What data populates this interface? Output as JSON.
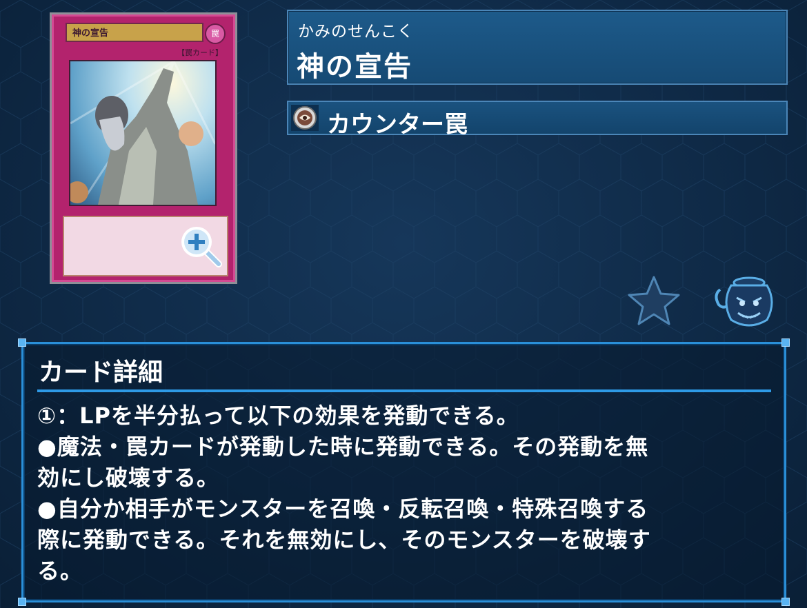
{
  "card": {
    "image_name": "神の宣告",
    "image_attribute": "罠",
    "image_type": "【罠カード】"
  },
  "header": {
    "ruby": "かみのせんこく",
    "title": "神の宣告"
  },
  "type": {
    "icon": "counter-trap-icon",
    "label": "カウンター罠"
  },
  "actions": {
    "favorite_icon": "star-icon",
    "pot_icon": "pot-of-greed-icon",
    "zoom_icon": "magnify-plus-icon"
  },
  "detail": {
    "heading": "カード詳細",
    "lines": [
      "①：LPを半分払って以下の効果を発動できる。",
      "●魔法・罠カードが発動した時に発動できる。その発動を無",
      "効にし破壊する。",
      "●自分か相手がモンスターを召喚・反転召喚・特殊召喚する",
      "際に発動できる。それを無効にし、そのモンスターを破壊す",
      "る。"
    ]
  },
  "colors": {
    "background": "#0f2a47",
    "panel": "#1d5a8a",
    "accent": "#2a8fd8",
    "card_frame": "#b3236d"
  }
}
